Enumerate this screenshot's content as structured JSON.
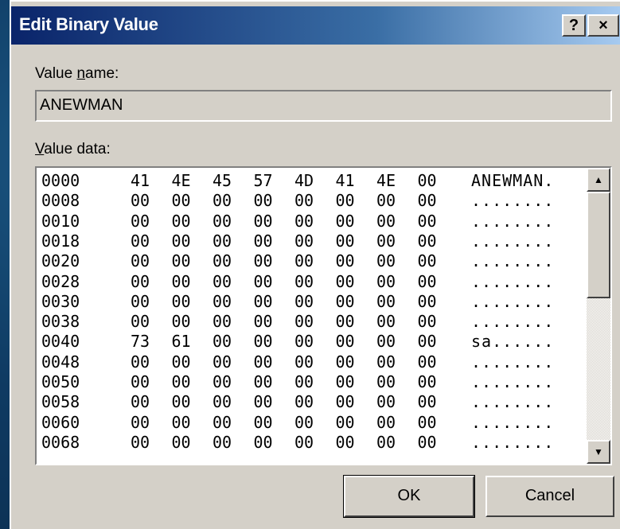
{
  "dialog": {
    "title": "Edit Binary Value",
    "help_glyph": "?",
    "close_glyph": "×",
    "value_name_label_pre": "Value ",
    "value_name_label_ul": "n",
    "value_name_label_post": "ame:",
    "value_name": "ANEWMAN",
    "value_data_label_ul": "V",
    "value_data_label_post": "alue data:",
    "ok_label": "OK",
    "cancel_label": "Cancel"
  },
  "hex_rows": [
    {
      "addr": "0000",
      "bytes": [
        "41",
        "4E",
        "45",
        "57",
        "4D",
        "41",
        "4E",
        "00"
      ],
      "ascii": "ANEWMAN."
    },
    {
      "addr": "0008",
      "bytes": [
        "00",
        "00",
        "00",
        "00",
        "00",
        "00",
        "00",
        "00"
      ],
      "ascii": "........"
    },
    {
      "addr": "0010",
      "bytes": [
        "00",
        "00",
        "00",
        "00",
        "00",
        "00",
        "00",
        "00"
      ],
      "ascii": "........"
    },
    {
      "addr": "0018",
      "bytes": [
        "00",
        "00",
        "00",
        "00",
        "00",
        "00",
        "00",
        "00"
      ],
      "ascii": "........"
    },
    {
      "addr": "0020",
      "bytes": [
        "00",
        "00",
        "00",
        "00",
        "00",
        "00",
        "00",
        "00"
      ],
      "ascii": "........"
    },
    {
      "addr": "0028",
      "bytes": [
        "00",
        "00",
        "00",
        "00",
        "00",
        "00",
        "00",
        "00"
      ],
      "ascii": "........"
    },
    {
      "addr": "0030",
      "bytes": [
        "00",
        "00",
        "00",
        "00",
        "00",
        "00",
        "00",
        "00"
      ],
      "ascii": "........"
    },
    {
      "addr": "0038",
      "bytes": [
        "00",
        "00",
        "00",
        "00",
        "00",
        "00",
        "00",
        "00"
      ],
      "ascii": "........"
    },
    {
      "addr": "0040",
      "bytes": [
        "73",
        "61",
        "00",
        "00",
        "00",
        "00",
        "00",
        "00"
      ],
      "ascii": "sa......"
    },
    {
      "addr": "0048",
      "bytes": [
        "00",
        "00",
        "00",
        "00",
        "00",
        "00",
        "00",
        "00"
      ],
      "ascii": "........"
    },
    {
      "addr": "0050",
      "bytes": [
        "00",
        "00",
        "00",
        "00",
        "00",
        "00",
        "00",
        "00"
      ],
      "ascii": "........"
    },
    {
      "addr": "0058",
      "bytes": [
        "00",
        "00",
        "00",
        "00",
        "00",
        "00",
        "00",
        "00"
      ],
      "ascii": "........"
    },
    {
      "addr": "0060",
      "bytes": [
        "00",
        "00",
        "00",
        "00",
        "00",
        "00",
        "00",
        "00"
      ],
      "ascii": "........"
    },
    {
      "addr": "0068",
      "bytes": [
        "00",
        "00",
        "00",
        "00",
        "00",
        "00",
        "00",
        "00"
      ],
      "ascii": "........"
    }
  ],
  "colors": {
    "title_gradient_start": "#0a246a",
    "dialog_face": "#d4d0c8"
  },
  "icons": {
    "scroll_up": "up-arrow-icon",
    "scroll_down": "down-arrow-icon"
  }
}
